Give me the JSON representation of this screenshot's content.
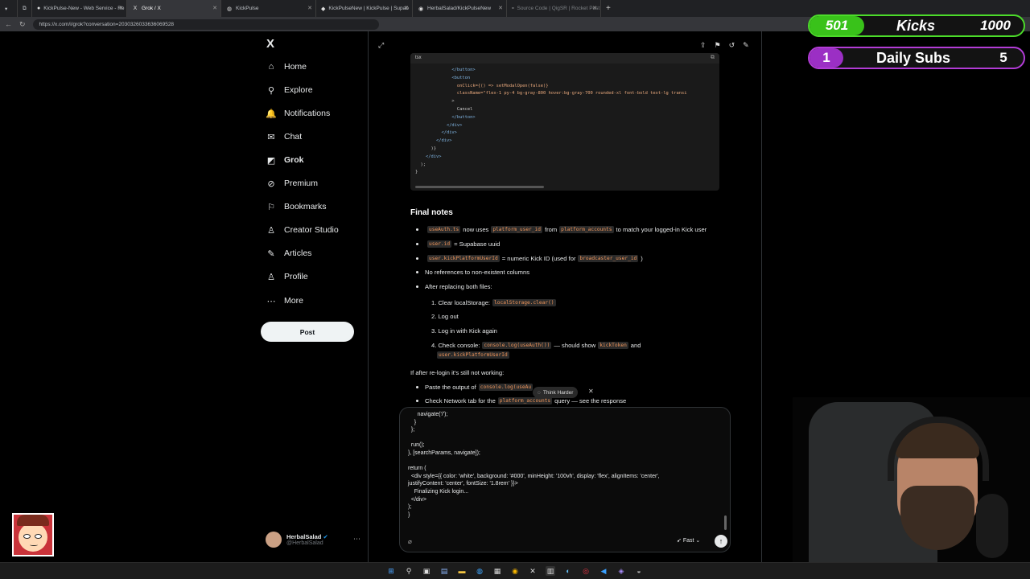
{
  "browser": {
    "tabs": [
      {
        "label": "KickPulse-New - Web Service - Re",
        "active": false
      },
      {
        "label": "Grok / X",
        "active": true
      },
      {
        "label": "KickPulse",
        "active": false
      },
      {
        "label": "KickPulseNew | KickPulse | Supab",
        "active": false
      },
      {
        "label": "HerbalSalad/KickPulseNew",
        "active": false
      },
      {
        "label": "Source Code | QigSR | Rocket Post",
        "active": false
      }
    ],
    "url": "https://x.com/i/grok?conversation=2030326033636069528"
  },
  "sidebar": {
    "logo": "X",
    "items": [
      {
        "label": "Home",
        "icon": "home-icon",
        "glyph": "⌂"
      },
      {
        "label": "Explore",
        "icon": "search-icon",
        "glyph": "⚲"
      },
      {
        "label": "Notifications",
        "icon": "bell-icon",
        "glyph": "🔔"
      },
      {
        "label": "Chat",
        "icon": "mail-icon",
        "glyph": "✉"
      },
      {
        "label": "Grok",
        "icon": "grok-icon",
        "glyph": "◩"
      },
      {
        "label": "Premium",
        "icon": "premium-icon",
        "glyph": "⊘"
      },
      {
        "label": "Bookmarks",
        "icon": "bookmark-icon",
        "glyph": "⚐"
      },
      {
        "label": "Creator Studio",
        "icon": "creator-icon",
        "glyph": "♙"
      },
      {
        "label": "Articles",
        "icon": "articles-icon",
        "glyph": "✎"
      },
      {
        "label": "Profile",
        "icon": "profile-icon",
        "glyph": "♙"
      },
      {
        "label": "More",
        "icon": "more-icon",
        "glyph": "⋯"
      }
    ],
    "post_label": "Post",
    "user": {
      "name": "HerbalSalad",
      "handle": "@HerbalSalad"
    }
  },
  "code": {
    "lang": "tsx",
    "lines": [
      "              </button>",
      "              <button",
      "                onClick={() => setModalOpen(false)}",
      "                className=\"flex-1 py-4 bg-gray-800 hover:bg-gray-700 rounded-xl font-bold text-lg transi",
      "              >",
      "                Cancel",
      "              </button>",
      "            </div>",
      "          </div>",
      "        </div>",
      "      )}",
      "    </div>",
      "  );",
      "}"
    ]
  },
  "content": {
    "heading": "Final notes",
    "bullets1": [
      {
        "code": "useAuth.ts",
        "text": " now uses ",
        "code2": "platform_user_id",
        "text2": " from ",
        "code3": "platform_accounts",
        "text3": " to match your logged-in Kick user"
      },
      {
        "code": "user.id",
        "text": " = Supabase uuid"
      },
      {
        "code": "user.kickPlatformUserId",
        "text": " = numeric Kick ID (used for ",
        "code2": "broadcaster_user_id",
        "text2": ")"
      },
      {
        "text": "No references to non-existent columns"
      },
      {
        "text": "After replacing both files:"
      }
    ],
    "steps": [
      {
        "text": "1. Clear localStorage: ",
        "code": "localStorage.clear()"
      },
      {
        "text": "2. Log out"
      },
      {
        "text": "3. Log in with Kick again"
      },
      {
        "text": "4. Check console: ",
        "code": "console.log(useAuth())",
        "text2": " — should show ",
        "code2": "kickToken",
        "text3": " and"
      },
      {
        "code": "user.kickPlatformUserId"
      }
    ],
    "if_fail": "If after re-login it's still not working:",
    "bullets2": [
      {
        "text": "Paste the output of ",
        "code": "console.log(useAu"
      },
      {
        "text": "Check Network tab for the ",
        "code": "platform_accounts",
        "text2": " query — see the response"
      }
    ],
    "think_harder": "Think Harder"
  },
  "composer": {
    "text": "      navigate('/');\n    }\n  };\n\n  run();\n}, [searchParams, navigate]);\n\nreturn (\n  <div style={{ color: 'white', background: '#000', minHeight: '100vh', display: 'flex', alignItems: 'center',\njustifyContent: 'center', fontSize: '1.8rem' }}>\n    Finalizing Kick login...\n  </div>\n);\n}",
    "mode": "Fast"
  },
  "overlay": {
    "kicks": {
      "count": "501",
      "label": "Kicks",
      "goal": "1000",
      "color": "#4cdb2a"
    },
    "subs": {
      "count": "1",
      "label": "Daily Subs",
      "goal": "5",
      "color": "#b23cd6"
    }
  }
}
